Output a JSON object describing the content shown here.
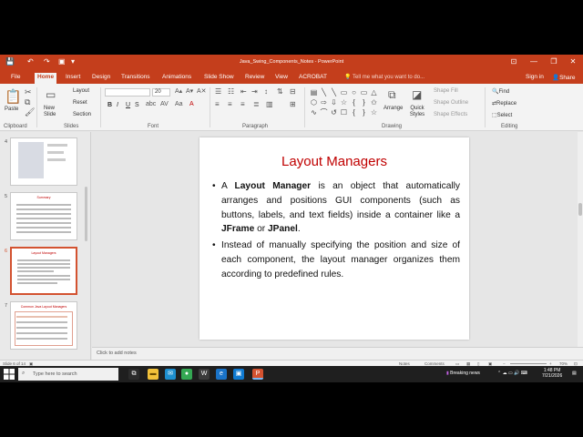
{
  "window": {
    "title": "Java_Swing_Components_Notes - PowerPoint",
    "controls": {
      "ribbon_options": "⊡",
      "minimize": "—",
      "restore": "❐",
      "close": "✕"
    }
  },
  "quick_access": {
    "save": "💾",
    "undo": "↶",
    "redo": "↷",
    "present": "▣",
    "more": "▾"
  },
  "tabs": [
    "File",
    "Home",
    "Insert",
    "Design",
    "Transitions",
    "Animations",
    "Slide Show",
    "Review",
    "View",
    "ACROBAT"
  ],
  "active_tab": "Home",
  "tell_me": "Tell me what you want to do...",
  "signin": "Sign in",
  "share": "Share",
  "ribbon": {
    "clipboard": {
      "label": "Clipboard",
      "paste": "Paste"
    },
    "slides": {
      "label": "Slides",
      "new_slide": "New Slide",
      "layout": "Layout",
      "reset": "Reset",
      "section": "Section"
    },
    "font": {
      "label": "Font",
      "bold": "B",
      "italic": "I",
      "underline": "U",
      "strike": "S",
      "font_size": "20"
    },
    "paragraph": {
      "label": "Paragraph"
    },
    "drawing": {
      "label": "Drawing",
      "arrange": "Arrange",
      "quick_styles": "Quick Styles",
      "shape_fill": "Shape Fill",
      "shape_outline": "Shape Outline",
      "shape_effects": "Shape Effects"
    },
    "editing": {
      "label": "Editing",
      "find": "Find",
      "replace": "Replace",
      "select": "Select"
    }
  },
  "thumbnails": [
    {
      "number": "4"
    },
    {
      "number": "5",
      "title": "Summary"
    },
    {
      "number": "6",
      "title": "Layout Managers"
    },
    {
      "number": "7",
      "title": "Common Java Layout Managers"
    }
  ],
  "slide": {
    "title": "Layout Managers",
    "bullet1": {
      "prefix": "A ",
      "bold1": "Layout Manager",
      "mid1": " is an object that automatically arranges and positions GUI components (such as buttons, labels, and text fields) inside a container like a ",
      "bold2": "JFrame",
      "mid2": " or ",
      "bold3": "JPanel",
      "suffix": "."
    },
    "bullet2": "Instead of manually specifying the position and size of each component, the layout manager organizes them according to predefined rules."
  },
  "notes_placeholder": "Click to add notes",
  "status": {
    "slide_info": "Slide 6 of 14",
    "notes": "Notes",
    "comments": "Comments",
    "zoom": "70%"
  },
  "taskbar": {
    "search_placeholder": "Type here to search",
    "news": "Breaking news",
    "time": "1:48 PM",
    "date": "7/21/2026"
  },
  "colors": {
    "accent": "#c43e1c",
    "title_red": "#c00000"
  }
}
